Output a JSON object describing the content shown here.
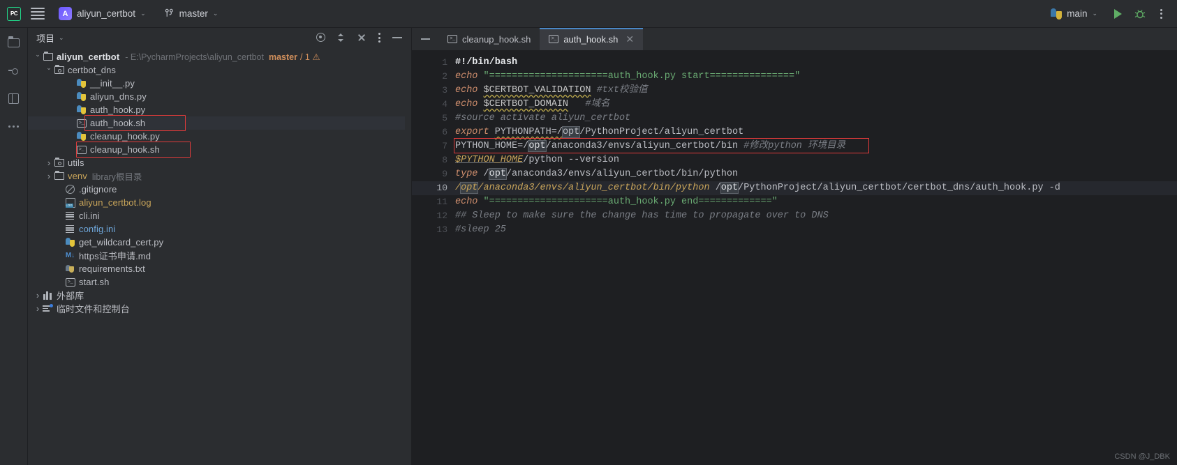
{
  "toolbar": {
    "logo_text": "PC",
    "menu_icon": "hamburger-icon",
    "project_initial": "A",
    "project_name": "aliyun_certbot",
    "vcs_icon": "branch-icon",
    "branch_name": "master",
    "run_config_name": "main",
    "run_icon": "run-triangle-icon",
    "debug_icon": "bug-icon",
    "more_icon": "kebab-icon"
  },
  "stripe": {
    "items": [
      {
        "name": "project-tool-button",
        "icon": "folder-icon"
      },
      {
        "name": "commit-tool-button",
        "icon": "commit-icon"
      },
      {
        "name": "structure-tool-button",
        "icon": "structure-icon"
      },
      {
        "name": "more-tool-button",
        "icon": "ellipsis-icon"
      }
    ]
  },
  "project_panel": {
    "title": "项目",
    "title_chevron": "chevron-down-icon",
    "actions": [
      {
        "name": "select-opened-file-button",
        "icon": "target-icon"
      },
      {
        "name": "expand-all-button",
        "icon": "expand-icon"
      },
      {
        "name": "collapse-all-button",
        "icon": "collapse-icon"
      },
      {
        "name": "options-button",
        "icon": "kebab-icon"
      },
      {
        "name": "hide-button",
        "icon": "minus-icon"
      }
    ],
    "tree": [
      {
        "label": "aliyun_certbot",
        "indent": 0,
        "arrow": "down",
        "icon": "folder",
        "bold": true,
        "path": "- E:\\PycharmProjects\\aliyun_certbot",
        "branch": "master",
        "branch_count": "/ 1 ⚠"
      },
      {
        "label": "certbot_dns",
        "indent": 1,
        "arrow": "down",
        "icon": "srcfolder"
      },
      {
        "label": "__init__.py",
        "indent": 3,
        "arrow": "none",
        "icon": "py"
      },
      {
        "label": "aliyun_dns.py",
        "indent": 3,
        "arrow": "none",
        "icon": "py"
      },
      {
        "label": "auth_hook.py",
        "indent": 3,
        "arrow": "none",
        "icon": "py"
      },
      {
        "label": "auth_hook.sh",
        "indent": 3,
        "arrow": "none",
        "icon": "sh",
        "selected": true,
        "boxed": true
      },
      {
        "label": "cleanup_hook.py",
        "indent": 3,
        "arrow": "none",
        "icon": "py"
      },
      {
        "label": "cleanup_hook.sh",
        "indent": 3,
        "arrow": "none",
        "icon": "sh",
        "boxed": true
      },
      {
        "label": "utils",
        "indent": 1,
        "arrow": "right",
        "icon": "srcfolder"
      },
      {
        "label": "venv",
        "indent": 1,
        "arrow": "right",
        "icon": "folder",
        "color": "yellow",
        "libtag": "library根目录"
      },
      {
        "label": ".gitignore",
        "indent": 2,
        "arrow": "none",
        "icon": "git"
      },
      {
        "label": "aliyun_certbot.log",
        "indent": 2,
        "arrow": "none",
        "icon": "log",
        "color": "yellow"
      },
      {
        "label": "cli.ini",
        "indent": 2,
        "arrow": "none",
        "icon": "ini"
      },
      {
        "label": "config.ini",
        "indent": 2,
        "arrow": "none",
        "icon": "ini",
        "color": "blue"
      },
      {
        "label": "get_wildcard_cert.py",
        "indent": 2,
        "arrow": "none",
        "icon": "py"
      },
      {
        "label": "https证书申请.md",
        "indent": 2,
        "arrow": "none",
        "icon": "md"
      },
      {
        "label": "requirements.txt",
        "indent": 2,
        "arrow": "none",
        "icon": "txt"
      },
      {
        "label": "start.sh",
        "indent": 2,
        "arrow": "none",
        "icon": "sh"
      },
      {
        "label": "外部库",
        "indent": 0,
        "arrow": "right",
        "icon": "lib"
      },
      {
        "label": "临时文件和控制台",
        "indent": 0,
        "arrow": "right",
        "icon": "scratch"
      }
    ]
  },
  "editor": {
    "hide_icon": "minus-icon",
    "tabs": [
      {
        "label": "cleanup_hook.sh",
        "icon": "sh-file-icon",
        "active": false,
        "closable": false
      },
      {
        "label": "auth_hook.sh",
        "icon": "sh-file-icon",
        "active": true,
        "closable": true,
        "close_icon": "close-icon"
      }
    ],
    "gutter_run_icon": "run-triangle-icon",
    "gutter_bulb_icon": "intention-bulb-icon",
    "current_line": 10,
    "lines": [
      {
        "n": 1,
        "text": "#!/bin/bash"
      },
      {
        "n": 2,
        "text": "echo \"=====================auth_hook.py start===============\""
      },
      {
        "n": 3,
        "text": "echo $CERTBOT_VALIDATION #txt校验值"
      },
      {
        "n": 4,
        "text": "echo $CERTBOT_DOMAIN   #域名"
      },
      {
        "n": 5,
        "text": "#source activate aliyun_certbot"
      },
      {
        "n": 6,
        "text": "export PYTHONPATH=/opt/PythonProject/aliyun_certbot"
      },
      {
        "n": 7,
        "text": "PYTHON_HOME=/opt/anaconda3/envs/aliyun_certbot/bin #修改python 环境目录"
      },
      {
        "n": 8,
        "text": "$PYTHON_HOME/python --version"
      },
      {
        "n": 9,
        "text": "type /opt/anaconda3/envs/aliyun_certbot/bin/python"
      },
      {
        "n": 10,
        "text": "/opt/anaconda3/envs/aliyun_certbot/bin/python /opt/PythonProject/aliyun_certbot/certbot_dns/auth_hook.py -d "
      },
      {
        "n": 11,
        "text": "echo \"=====================auth_hook.py end=============\""
      },
      {
        "n": 12,
        "text": "## Sleep to make sure the change has time to propagate over to DNS"
      },
      {
        "n": 13,
        "text": "#sleep 25"
      }
    ]
  },
  "watermark": "CSDN @J_DBK"
}
